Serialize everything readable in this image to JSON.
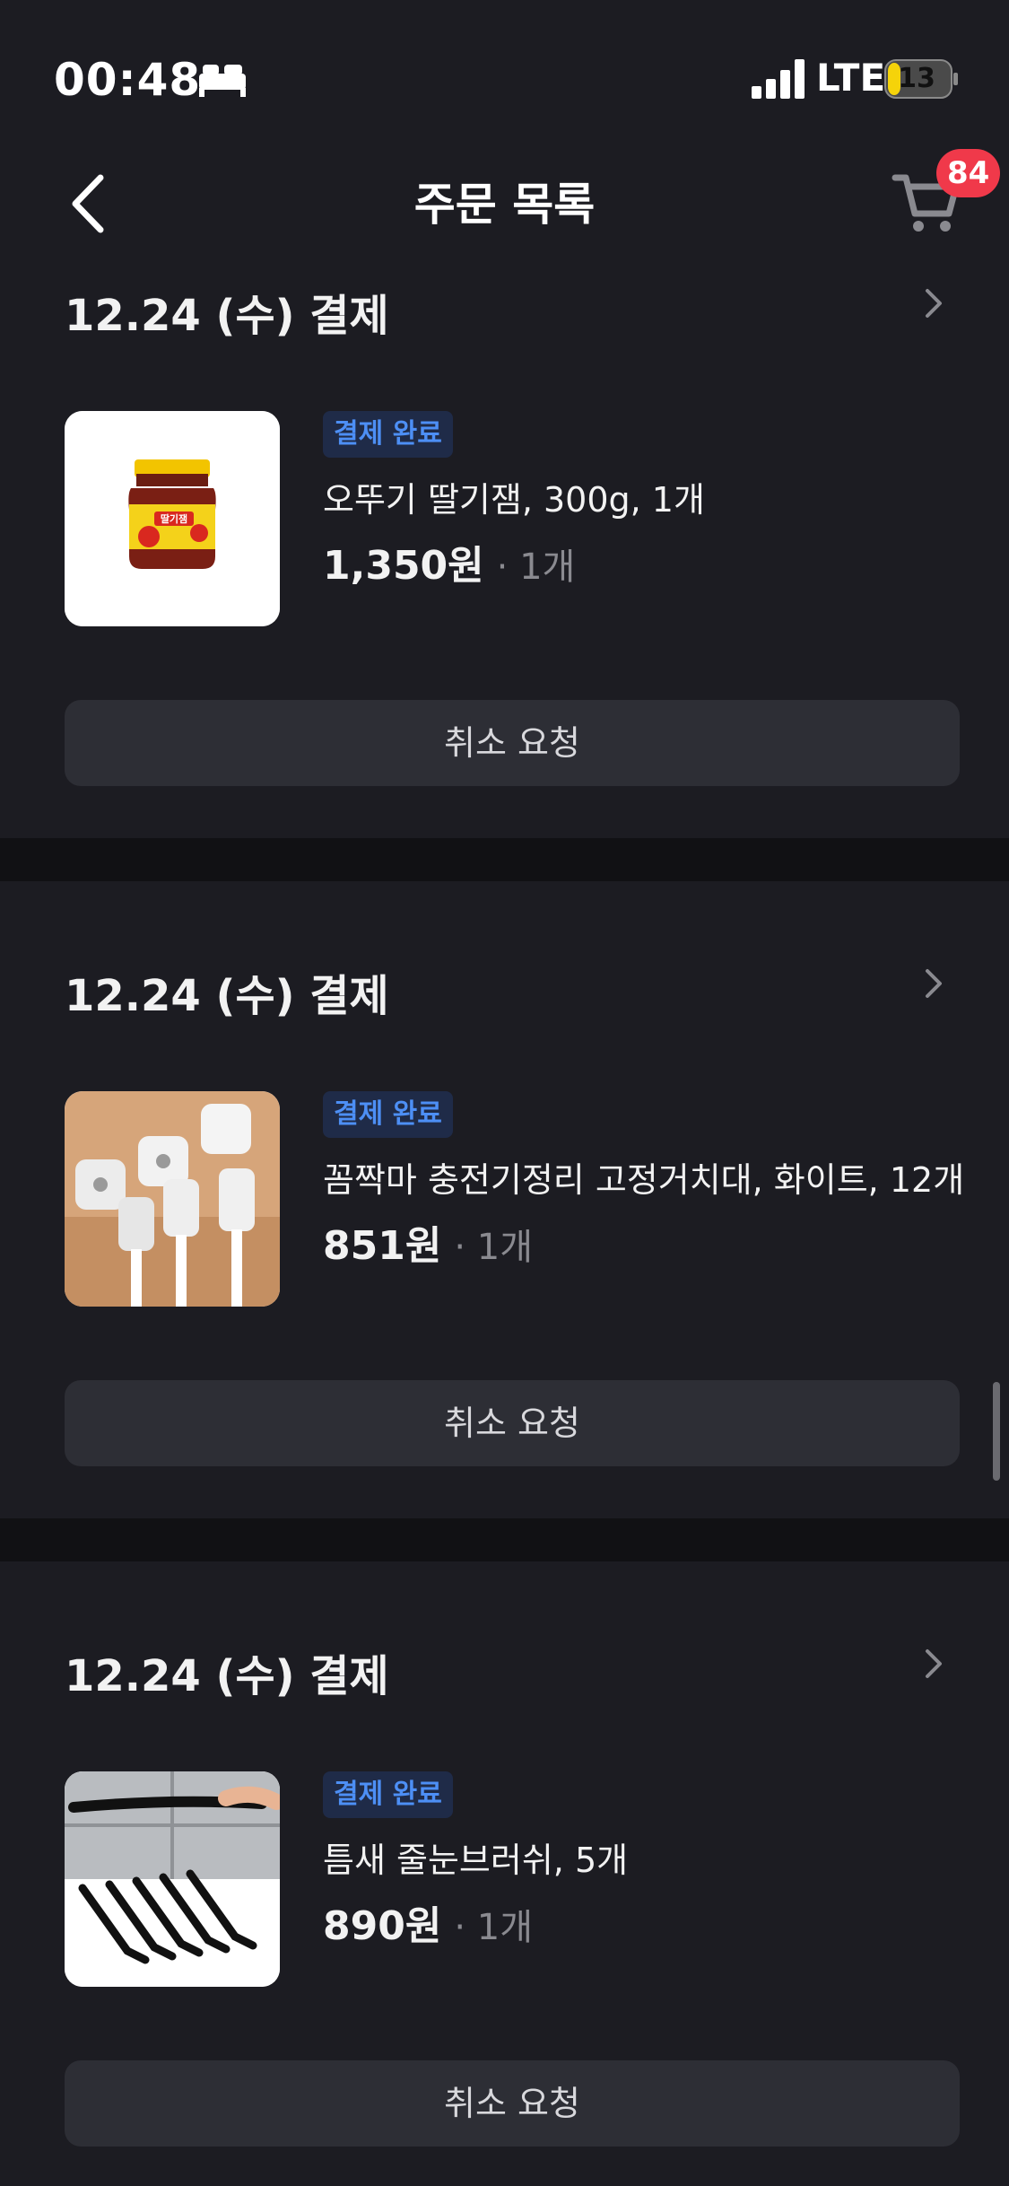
{
  "status_bar": {
    "time": "00:48",
    "network": "LTE",
    "battery": "13"
  },
  "nav": {
    "title": "주문 목록",
    "cart_count": "84"
  },
  "orders": [
    {
      "date": "12.24 (수) 결제",
      "status": "결제 완료",
      "product": "오뚜기 딸기잼, 300g, 1개",
      "price": "1,350원",
      "qty": "· 1개",
      "action": "취소 요청",
      "thumb_label": "딸기잼"
    },
    {
      "date": "12.24 (수) 결제",
      "status": "결제 완료",
      "product": "꼼짝마 충전기정리 고정거치대, 화이트, 12개",
      "price": "851원",
      "qty": "· 1개",
      "action": "취소 요청"
    },
    {
      "date": "12.24 (수) 결제",
      "status": "결제 완료",
      "product": "틈새 줄눈브러쉬, 5개",
      "price": "890원",
      "qty": "· 1개",
      "action": "취소 요청"
    }
  ],
  "colors": {
    "background": "#1c1c22",
    "badge_bg": "#1f2b48",
    "badge_text": "#4d8ff5",
    "cart_badge": "#f0394a",
    "button_bg": "#2d2e35"
  },
  "icons": [
    "bed-icon",
    "signal-icon",
    "battery-icon",
    "back-arrow-icon",
    "cart-icon",
    "chevron-right-icon"
  ]
}
